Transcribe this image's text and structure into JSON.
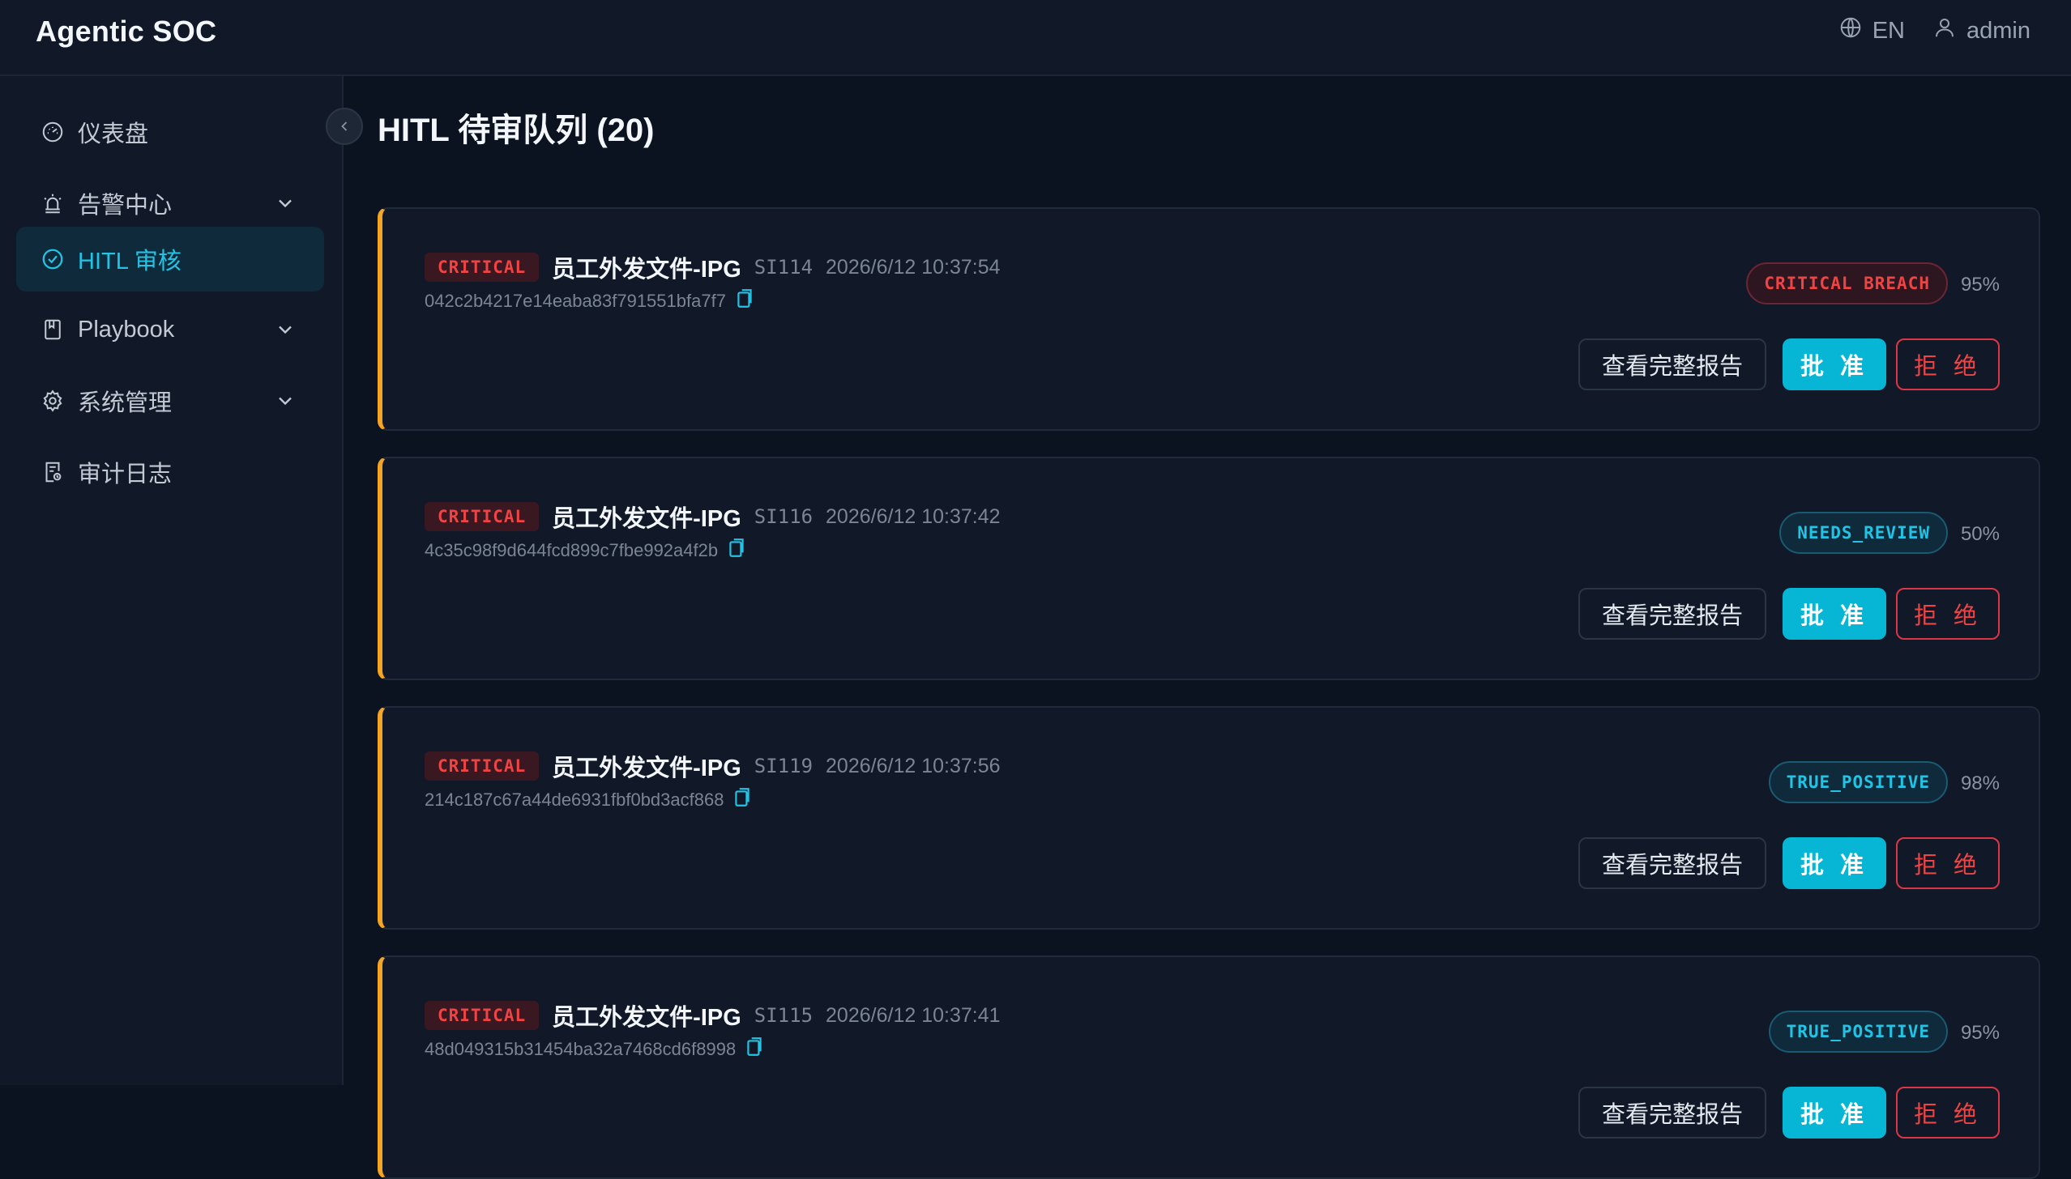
{
  "app": {
    "title": "Agentic SOC"
  },
  "header": {
    "language": "EN",
    "user": "admin"
  },
  "sidebar": {
    "items": [
      {
        "label": "仪表盘",
        "icon": "dashboard-icon",
        "expandable": false,
        "active": false
      },
      {
        "label": "告警中心",
        "icon": "alarm-icon",
        "expandable": true,
        "active": false
      },
      {
        "label": "HITL 审核",
        "icon": "check-circle-icon",
        "expandable": false,
        "active": true
      },
      {
        "label": "Playbook",
        "icon": "book-icon",
        "expandable": true,
        "active": false
      },
      {
        "label": "系统管理",
        "icon": "gear-icon",
        "expandable": true,
        "active": false
      },
      {
        "label": "审计日志",
        "icon": "audit-log-icon",
        "expandable": false,
        "active": false
      }
    ]
  },
  "main": {
    "title": "HITL 待审队列 (20)",
    "actions": {
      "report": "查看完整报告",
      "approve": "批 准",
      "reject": "拒 绝"
    },
    "cards": [
      {
        "severity": "CRITICAL",
        "title": "员工外发文件-IPG",
        "id": "SI114",
        "time": "2026/6/12 10:37:54",
        "hash": "042c2b4217e14eaba83f791551bfa7f7",
        "verdict": "CRITICAL_BREACH_DISPLAY",
        "verdict_text": "CRITICAL BREACH",
        "verdict_style": "red",
        "confidence": "95%"
      },
      {
        "severity": "CRITICAL",
        "title": "员工外发文件-IPG",
        "id": "SI116",
        "time": "2026/6/12 10:37:42",
        "hash": "4c35c98f9d644fcd899c7fbe992a4f2b",
        "verdict_text": "NEEDS_REVIEW",
        "verdict_style": "cyan",
        "confidence": "50%"
      },
      {
        "severity": "CRITICAL",
        "title": "员工外发文件-IPG",
        "id": "SI119",
        "time": "2026/6/12 10:37:56",
        "hash": "214c187c67a44de6931fbf0bd3acf868",
        "verdict_text": "TRUE_POSITIVE",
        "verdict_style": "cyan",
        "confidence": "98%"
      },
      {
        "severity": "CRITICAL",
        "title": "员工外发文件-IPG",
        "id": "SI115",
        "time": "2026/6/12 10:37:41",
        "hash": "48d049315b31454ba32a7468cd6f8998",
        "verdict_text": "TRUE_POSITIVE",
        "verdict_style": "cyan",
        "confidence": "95%"
      }
    ]
  },
  "colors": {
    "accent": "#06b6d4",
    "critical": "#ef4444",
    "warning_border": "#f5a524",
    "background": "#0b1220",
    "panel": "#111827"
  }
}
